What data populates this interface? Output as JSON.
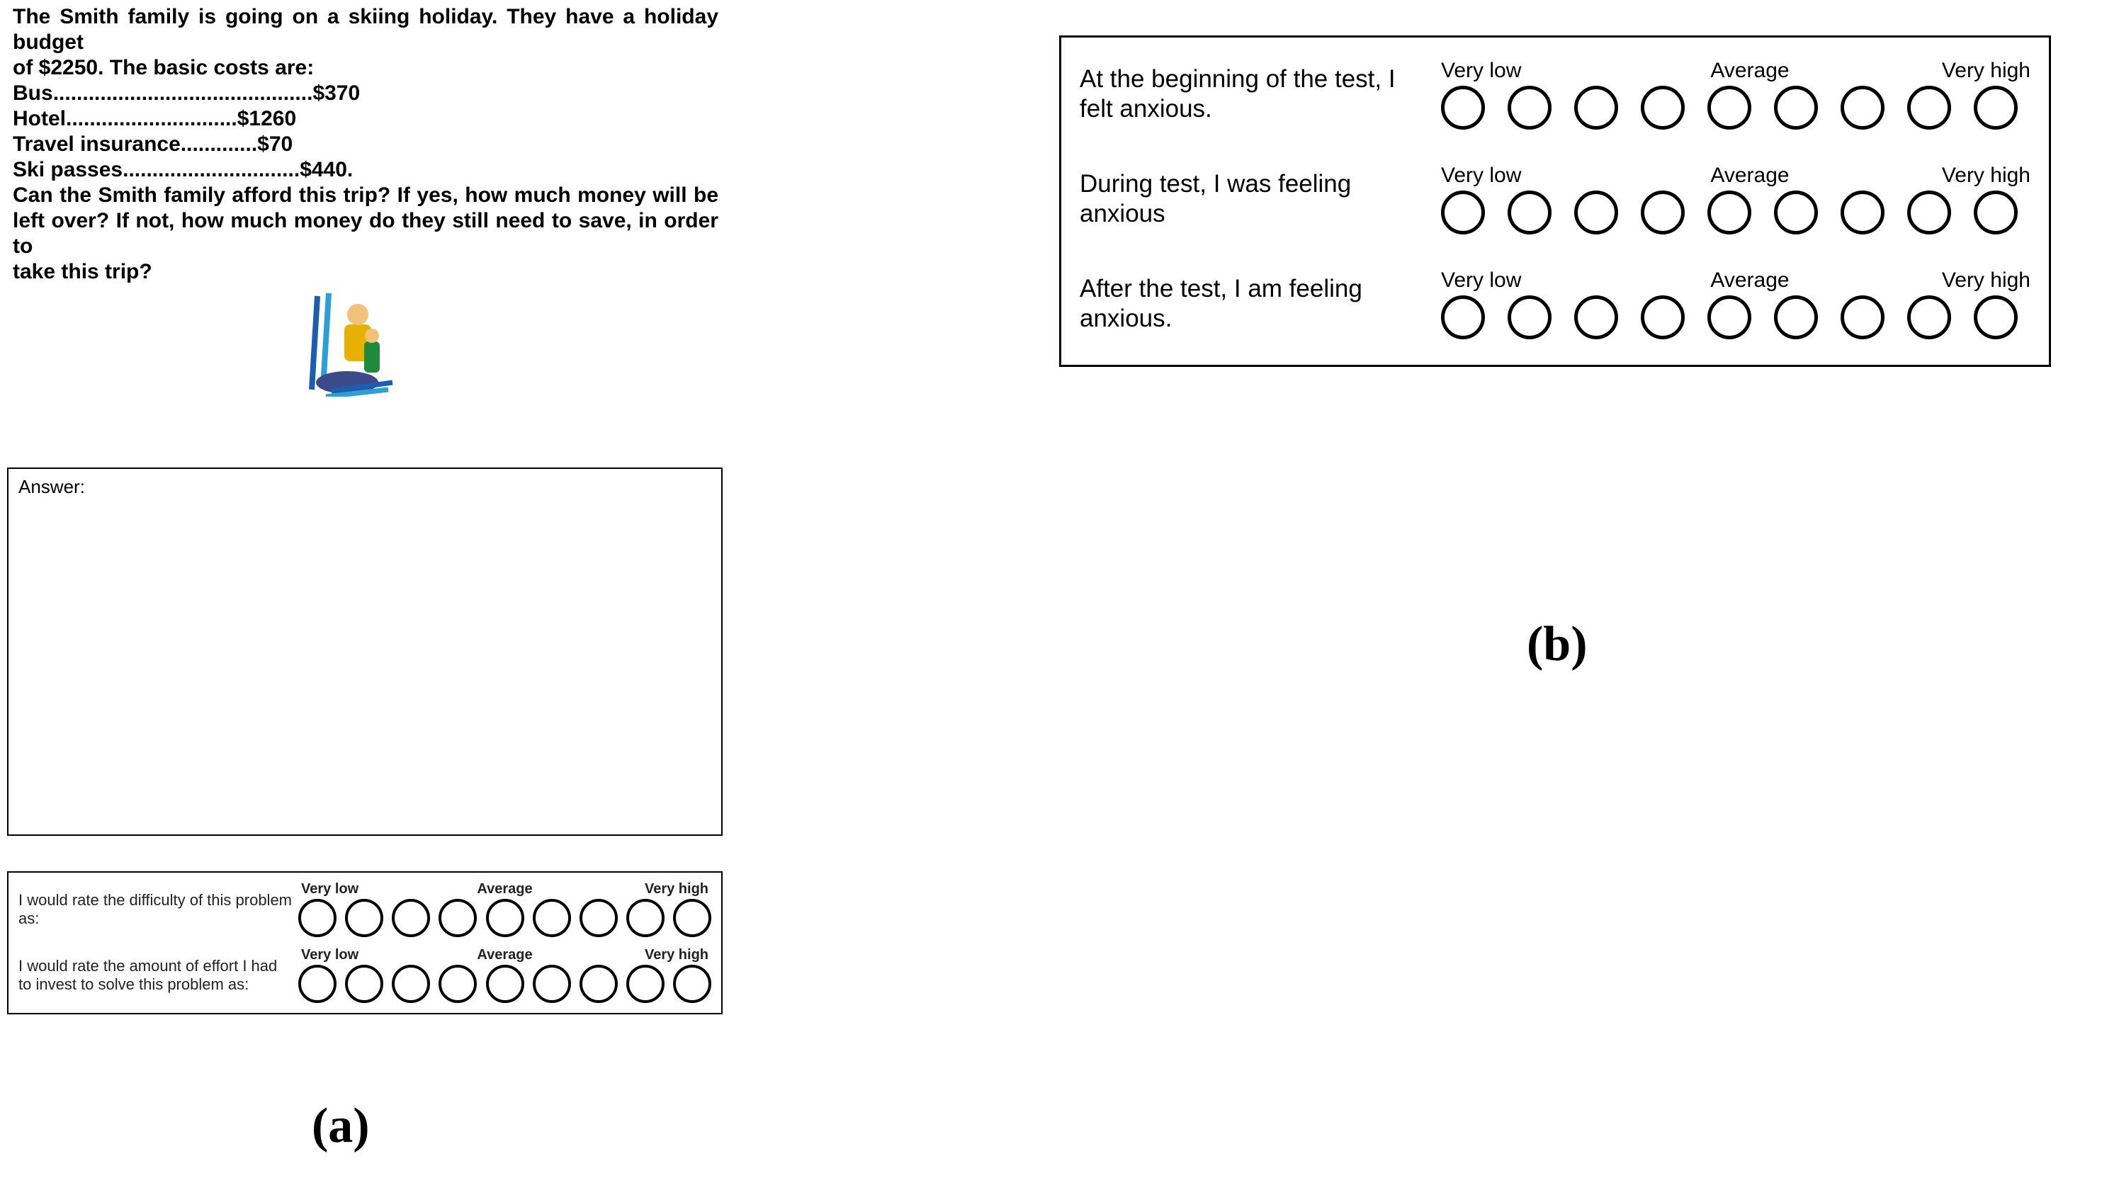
{
  "problem": {
    "intro1": "The Smith family is going on a skiing holiday. They have a holiday budget",
    "intro2": "of $2250. The basic costs are:",
    "costs": [
      {
        "label": "Bus",
        "dots": "............................................",
        "value": " $370"
      },
      {
        "label": "Hotel",
        "dots": ".............................",
        "value": "$1260"
      },
      {
        "label": "Travel insurance",
        "dots": ".............",
        "value": " $70"
      },
      {
        "label": "Ski passes",
        "dots": "..............................",
        "value": "$440."
      }
    ],
    "q1": "Can the Smith family afford this trip? If yes, how much money will be",
    "q2": "left over? If not, how much money do they still need to save, in order to",
    "q3": "take this trip?"
  },
  "answer_label": "Answer:",
  "small_scales": {
    "labels": {
      "low": "Very low",
      "mid": "Average",
      "high": "Very high"
    },
    "rows": [
      {
        "prompt": "I would rate the difficulty of this problem as:"
      },
      {
        "prompt": "I would rate the amount of effort I had to invest to solve this problem as:"
      }
    ]
  },
  "big_scales": {
    "labels": {
      "low": "Very low",
      "mid": "Average",
      "high": "Very high"
    },
    "rows": [
      {
        "prompt": "At the beginning of the test, I felt anxious."
      },
      {
        "prompt": "During test, I was feeling anxious"
      },
      {
        "prompt": "After the test, I am feeling anxious."
      }
    ]
  },
  "fig_labels": {
    "a": "(a)",
    "b": "(b)"
  }
}
